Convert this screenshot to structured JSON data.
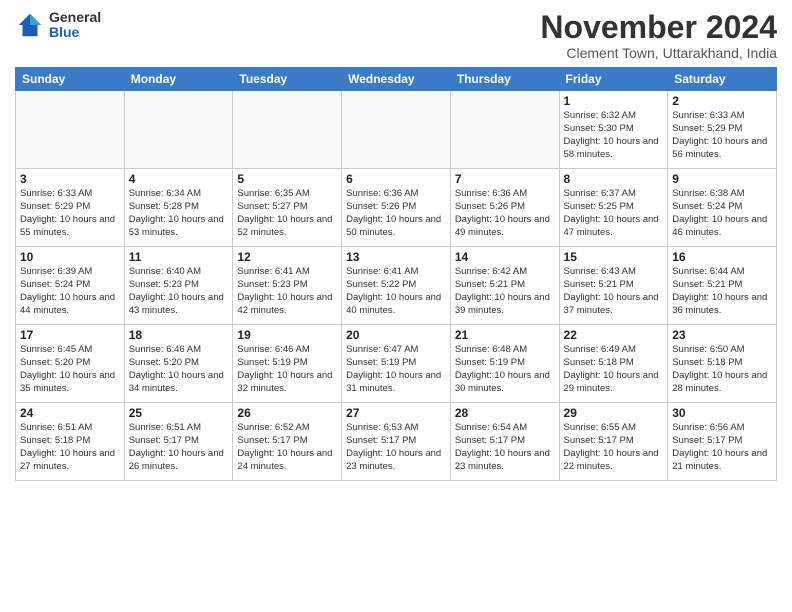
{
  "header": {
    "logo_general": "General",
    "logo_blue": "Blue",
    "month_title": "November 2024",
    "location": "Clement Town, Uttarakhand, India"
  },
  "weekdays": [
    "Sunday",
    "Monday",
    "Tuesday",
    "Wednesday",
    "Thursday",
    "Friday",
    "Saturday"
  ],
  "weeks": [
    [
      {
        "day": "",
        "info": ""
      },
      {
        "day": "",
        "info": ""
      },
      {
        "day": "",
        "info": ""
      },
      {
        "day": "",
        "info": ""
      },
      {
        "day": "",
        "info": ""
      },
      {
        "day": "1",
        "info": "Sunrise: 6:32 AM\nSunset: 5:30 PM\nDaylight: 10 hours and 58 minutes."
      },
      {
        "day": "2",
        "info": "Sunrise: 6:33 AM\nSunset: 5:29 PM\nDaylight: 10 hours and 56 minutes."
      }
    ],
    [
      {
        "day": "3",
        "info": "Sunrise: 6:33 AM\nSunset: 5:29 PM\nDaylight: 10 hours and 55 minutes."
      },
      {
        "day": "4",
        "info": "Sunrise: 6:34 AM\nSunset: 5:28 PM\nDaylight: 10 hours and 53 minutes."
      },
      {
        "day": "5",
        "info": "Sunrise: 6:35 AM\nSunset: 5:27 PM\nDaylight: 10 hours and 52 minutes."
      },
      {
        "day": "6",
        "info": "Sunrise: 6:36 AM\nSunset: 5:26 PM\nDaylight: 10 hours and 50 minutes."
      },
      {
        "day": "7",
        "info": "Sunrise: 6:36 AM\nSunset: 5:26 PM\nDaylight: 10 hours and 49 minutes."
      },
      {
        "day": "8",
        "info": "Sunrise: 6:37 AM\nSunset: 5:25 PM\nDaylight: 10 hours and 47 minutes."
      },
      {
        "day": "9",
        "info": "Sunrise: 6:38 AM\nSunset: 5:24 PM\nDaylight: 10 hours and 46 minutes."
      }
    ],
    [
      {
        "day": "10",
        "info": "Sunrise: 6:39 AM\nSunset: 5:24 PM\nDaylight: 10 hours and 44 minutes."
      },
      {
        "day": "11",
        "info": "Sunrise: 6:40 AM\nSunset: 5:23 PM\nDaylight: 10 hours and 43 minutes."
      },
      {
        "day": "12",
        "info": "Sunrise: 6:41 AM\nSunset: 5:23 PM\nDaylight: 10 hours and 42 minutes."
      },
      {
        "day": "13",
        "info": "Sunrise: 6:41 AM\nSunset: 5:22 PM\nDaylight: 10 hours and 40 minutes."
      },
      {
        "day": "14",
        "info": "Sunrise: 6:42 AM\nSunset: 5:21 PM\nDaylight: 10 hours and 39 minutes."
      },
      {
        "day": "15",
        "info": "Sunrise: 6:43 AM\nSunset: 5:21 PM\nDaylight: 10 hours and 37 minutes."
      },
      {
        "day": "16",
        "info": "Sunrise: 6:44 AM\nSunset: 5:21 PM\nDaylight: 10 hours and 36 minutes."
      }
    ],
    [
      {
        "day": "17",
        "info": "Sunrise: 6:45 AM\nSunset: 5:20 PM\nDaylight: 10 hours and 35 minutes."
      },
      {
        "day": "18",
        "info": "Sunrise: 6:46 AM\nSunset: 5:20 PM\nDaylight: 10 hours and 34 minutes."
      },
      {
        "day": "19",
        "info": "Sunrise: 6:46 AM\nSunset: 5:19 PM\nDaylight: 10 hours and 32 minutes."
      },
      {
        "day": "20",
        "info": "Sunrise: 6:47 AM\nSunset: 5:19 PM\nDaylight: 10 hours and 31 minutes."
      },
      {
        "day": "21",
        "info": "Sunrise: 6:48 AM\nSunset: 5:19 PM\nDaylight: 10 hours and 30 minutes."
      },
      {
        "day": "22",
        "info": "Sunrise: 6:49 AM\nSunset: 5:18 PM\nDaylight: 10 hours and 29 minutes."
      },
      {
        "day": "23",
        "info": "Sunrise: 6:50 AM\nSunset: 5:18 PM\nDaylight: 10 hours and 28 minutes."
      }
    ],
    [
      {
        "day": "24",
        "info": "Sunrise: 6:51 AM\nSunset: 5:18 PM\nDaylight: 10 hours and 27 minutes."
      },
      {
        "day": "25",
        "info": "Sunrise: 6:51 AM\nSunset: 5:17 PM\nDaylight: 10 hours and 26 minutes."
      },
      {
        "day": "26",
        "info": "Sunrise: 6:52 AM\nSunset: 5:17 PM\nDaylight: 10 hours and 24 minutes."
      },
      {
        "day": "27",
        "info": "Sunrise: 6:53 AM\nSunset: 5:17 PM\nDaylight: 10 hours and 23 minutes."
      },
      {
        "day": "28",
        "info": "Sunrise: 6:54 AM\nSunset: 5:17 PM\nDaylight: 10 hours and 23 minutes."
      },
      {
        "day": "29",
        "info": "Sunrise: 6:55 AM\nSunset: 5:17 PM\nDaylight: 10 hours and 22 minutes."
      },
      {
        "day": "30",
        "info": "Sunrise: 6:56 AM\nSunset: 5:17 PM\nDaylight: 10 hours and 21 minutes."
      }
    ]
  ]
}
